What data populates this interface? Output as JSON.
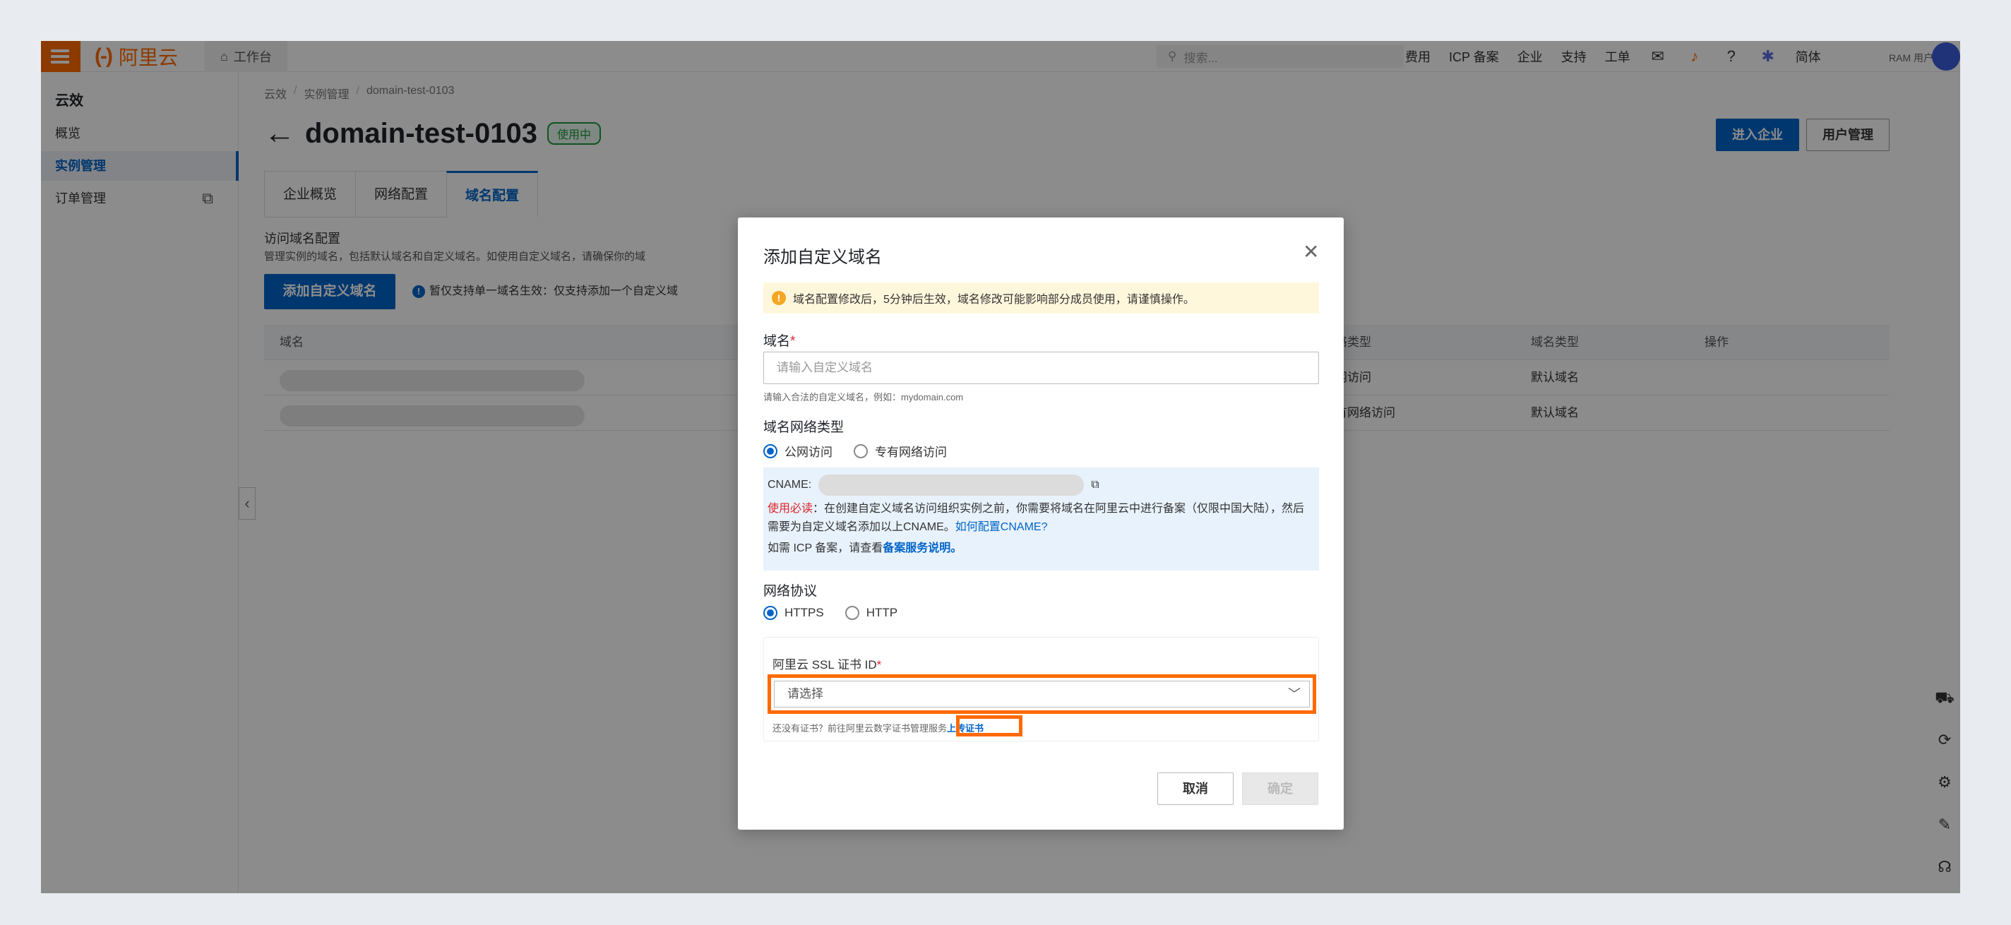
{
  "topbar": {
    "logo_bracket": "(-)",
    "logo_text": "阿里云",
    "workbench": "工作台",
    "search_placeholder": "搜索...",
    "links": [
      "费用",
      "ICP 备案",
      "企业",
      "支持",
      "工单"
    ],
    "lang": "简体",
    "ram_user": "RAM 用户"
  },
  "sidebar": {
    "title": "云效",
    "items": [
      {
        "label": "概览"
      },
      {
        "label": "实例管理"
      },
      {
        "label": "订单管理"
      }
    ]
  },
  "main": {
    "breadcrumb": [
      "云效",
      "实例管理",
      "domain-test-0103"
    ],
    "title": "domain-test-0103",
    "status": "使用中",
    "enter_btn": "进入企业",
    "user_btn": "用户管理",
    "tabs": [
      "企业概览",
      "网络配置",
      "域名配置"
    ],
    "section_title": "访问域名配置",
    "section_desc": "管理实例的域名，包括默认域名和自定义域名。如使用自定义域名，请确保你的域",
    "add_btn": "添加自定义域名",
    "tip": "暂仅支持单一域名生效：仅支持添加一个自定义域",
    "columns": [
      "域名",
      "网络类型",
      "域名类型",
      "操作"
    ],
    "rows": [
      {
        "network": "公网访问",
        "type": "默认域名"
      },
      {
        "network": "专有网络访问",
        "type": "默认域名"
      }
    ]
  },
  "modal": {
    "title": "添加自定义域名",
    "warning": "域名配置修改后，5分钟后生效，域名修改可能影响部分成员使用，请谨慎操作。",
    "domain_label": "域名",
    "domain_placeholder": "请输入自定义域名",
    "domain_hint": "请输入合法的自定义域名，例如：mydomain.com",
    "net_label": "域名网络类型",
    "net_options": [
      "公网访问",
      "专有网络访问"
    ],
    "cname_label": "CNAME:",
    "must_read": "使用必读",
    "must_text": "：在创建自定义域名访问组织实例之前，你需要将域名在阿里云中进行备案（仅限中国大陆），然后需要为自定义域名添加以上CNAME。",
    "cname_link": "如何配置CNAME?",
    "icp_text": "如需 ICP 备案，请查看",
    "icp_link": "备案服务说明。",
    "proto_label": "网络协议",
    "proto_options": [
      "HTTPS",
      "HTTP"
    ],
    "ssl_label": "阿里云 SSL 证书 ID",
    "ssl_placeholder": "请选择",
    "ssl_hint": "还没有证书？前往阿里云数字证书管理服务",
    "ssl_upload": "上传证书",
    "cancel": "取消",
    "ok": "确定"
  },
  "colors": {
    "brand": "#ff6a00",
    "primary": "#0064c8",
    "highlight": "#ff6a00"
  }
}
